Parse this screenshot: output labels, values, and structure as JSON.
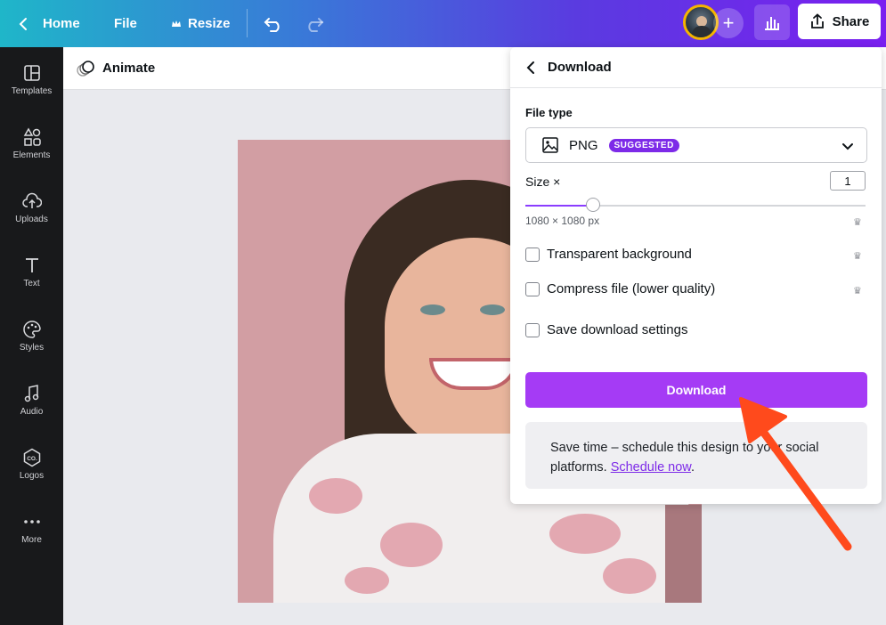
{
  "topbar": {
    "home_label": "Home",
    "file_label": "File",
    "resize_label": "Resize",
    "share_label": "Share"
  },
  "sidebar": {
    "items": [
      {
        "label": "Templates",
        "icon": "templates-icon"
      },
      {
        "label": "Elements",
        "icon": "elements-icon"
      },
      {
        "label": "Uploads",
        "icon": "uploads-icon"
      },
      {
        "label": "Text",
        "icon": "text-icon"
      },
      {
        "label": "Styles",
        "icon": "styles-icon"
      },
      {
        "label": "Audio",
        "icon": "audio-icon"
      },
      {
        "label": "Logos",
        "icon": "logos-icon"
      },
      {
        "label": "More",
        "icon": "more-icon"
      }
    ]
  },
  "subbar": {
    "animate_label": "Animate"
  },
  "download_panel": {
    "title": "Download",
    "file_type_label": "File type",
    "file_type_value": "PNG",
    "suggested_badge": "SUGGESTED",
    "size_label": "Size ×",
    "size_value": "1",
    "size_slider_fraction": 0.2,
    "dimensions": "1080 × 1080 px",
    "options": [
      {
        "label": "Transparent background",
        "checked": false,
        "premium": true
      },
      {
        "label": "Compress file (lower quality)",
        "checked": false,
        "premium": true
      },
      {
        "label": "Save download settings",
        "checked": false,
        "premium": false
      }
    ],
    "download_button": "Download",
    "promo_text": "Save time – schedule this design to your social platforms. ",
    "promo_link": "Schedule now",
    "promo_end": "."
  },
  "colors": {
    "accent": "#8b3dff",
    "download_button": "#a53bf5",
    "badge": "#7d2ae8",
    "annotation_arrow": "#ff4a1c",
    "canvas_background": "#d29ea3"
  }
}
